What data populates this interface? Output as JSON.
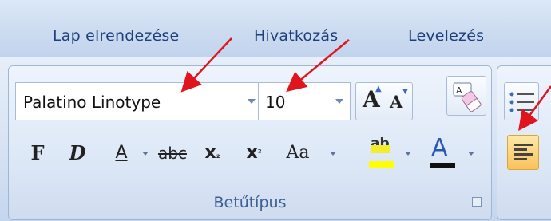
{
  "tabs": [
    {
      "label": "Lap elrendezése"
    },
    {
      "label": "Hivatkozás"
    },
    {
      "label": "Levelezés"
    }
  ],
  "font_group": {
    "font_name": "Palatino Linotype",
    "font_size": "10",
    "label": "Betűtípus",
    "buttons": {
      "bold": "F",
      "italic": "D",
      "underline": "A",
      "strikethrough": "abc",
      "subscript": "x",
      "subscript_mark": "₂",
      "superscript": "x",
      "superscript_mark": "²",
      "change_case": "Aa",
      "grow_font": "A",
      "shrink_font": "A",
      "font_color": "A",
      "highlight": "ab"
    }
  },
  "icons": [
    "grow-font-icon",
    "shrink-font-icon",
    "clear-formatting-icon",
    "highlight-icon",
    "font-color-icon",
    "bullets-icon",
    "align-left-icon",
    "dialog-launcher-icon",
    "red-arrow-icon"
  ],
  "colors": {
    "tab_text": "#1e3f7c",
    "group_label": "#3d5f94",
    "arrow": "#e0141c",
    "font_color_bar": "#101010",
    "highlight_yellow": "#ffff00",
    "align_active": "#f9c25a"
  }
}
